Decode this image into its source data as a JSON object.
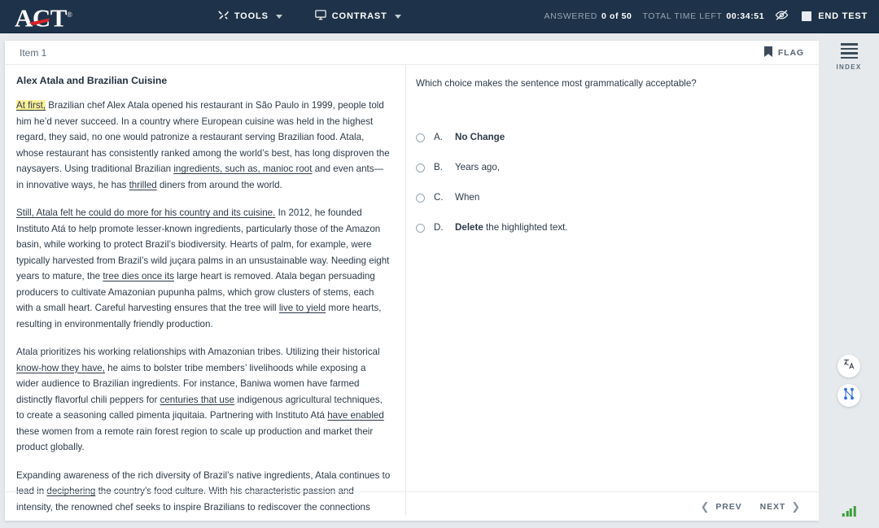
{
  "brand": {
    "name": "ACT",
    "registered": "®",
    "accent_red": "#d8232a",
    "bar_color": "#1e3349"
  },
  "topnav": {
    "tools_label": "TOOLS",
    "tools_icon": "tools-wrench-icon",
    "contrast_label": "CONTRAST",
    "contrast_icon": "monitor-icon",
    "answered_label": "ANSWERED",
    "answered_value": "0 of 50",
    "time_label": "TOTAL TIME LEFT",
    "time_value": "00:34:51",
    "hide_icon": "eye-slash-icon",
    "end_test_label": "END TEST"
  },
  "item_header": {
    "item_label": "Item 1",
    "flag_label": "FLAG",
    "flag_icon": "bookmark-flag-icon"
  },
  "passage": {
    "title": "Alex Atala and Brazilian Cuisine",
    "paragraphs": [
      {
        "segments": [
          {
            "text": "At first,",
            "style": "highlight"
          },
          {
            "text": " Brazilian chef Alex Atala opened his restaurant in São Paulo in 1999, people told him he’d never succeed. In a country where European cuisine was held in the highest regard, they said, no one would patronize a restaurant serving Brazilian food. Atala, whose restaurant has consistently ranked among the world’s best, has long disproven the naysayers. Using traditional Brazilian ",
            "style": "plain"
          },
          {
            "text": "ingredients, such as, manioc root",
            "style": "underline"
          },
          {
            "text": " and even ants—in innovative ways, he has ",
            "style": "plain"
          },
          {
            "text": "thrilled",
            "style": "underline"
          },
          {
            "text": " diners from around the world.",
            "style": "plain"
          }
        ]
      },
      {
        "segments": [
          {
            "text": "Still, Atala felt he could do more for his country and its cuisine.",
            "style": "underline"
          },
          {
            "text": " In 2012, he founded Instituto Atá to help promote lesser-known ingredients, particularly those of the Amazon basin, while working to protect Brazil’s biodiversity. Hearts of palm, for example, were typically harvested from Brazil’s wild juçara palms in an unsustainable way. Needing eight years to mature, the ",
            "style": "plain"
          },
          {
            "text": "tree dies once its",
            "style": "underline"
          },
          {
            "text": " large heart is removed. Atala began persuading producers to cultivate Amazonian pupunha palms, which grow clusters of stems, each with a small heart. Careful harvesting ensures that the tree will ",
            "style": "plain"
          },
          {
            "text": "live to yield",
            "style": "underline"
          },
          {
            "text": " more hearts, resulting in environmentally friendly production.",
            "style": "plain"
          }
        ]
      },
      {
        "segments": [
          {
            "text": "Atala prioritizes his working relationships with Amazonian tribes. Utilizing their historical ",
            "style": "plain"
          },
          {
            "text": "know-how they have,",
            "style": "underline"
          },
          {
            "text": " he aims to bolster tribe members’ livelihoods while exposing a wider audience to Brazilian ingredients. For instance, Baniwa women have farmed distinctly flavorful chili peppers for ",
            "style": "plain"
          },
          {
            "text": "centuries that use",
            "style": "underline"
          },
          {
            "text": " indigenous agricultural techniques, to create a seasoning called pimenta jiquitaia. Partnering with Instituto Atá ",
            "style": "plain"
          },
          {
            "text": "have enabled",
            "style": "underline"
          },
          {
            "text": " these women from a remote rain forest region to scale up production and market their product globally.",
            "style": "plain"
          }
        ]
      },
      {
        "segments": [
          {
            "text": "Expanding awareness of the rich diversity of Brazil’s native ingredients, Atala continues to lead in ",
            "style": "plain"
          },
          {
            "text": "deciphering",
            "style": "underline"
          },
          {
            "text": " the country’s food culture. With his characteristic passion and intensity, the renowned chef seeks to inspire Brazilians to rediscover the connections between culture, nature, and food.",
            "style": "plain"
          }
        ]
      }
    ],
    "highlight_color": "#fbf098"
  },
  "question": {
    "prompt": "Which choice makes the sentence most grammatically acceptable?",
    "choices": [
      {
        "letter": "A.",
        "bold": "No Change",
        "rest": ""
      },
      {
        "letter": "B.",
        "bold": "",
        "rest": "Years ago,"
      },
      {
        "letter": "C.",
        "bold": "",
        "rest": "When"
      },
      {
        "letter": "D.",
        "bold": "Delete",
        "rest": " the highlighted text."
      }
    ],
    "selected": null
  },
  "footer": {
    "prev_label": "PREV",
    "next_label": "NEXT",
    "prev_icon": "chevron-left-icon",
    "next_icon": "chevron-right-icon"
  },
  "rail": {
    "index_label": "INDEX",
    "index_icon": "hamburger-menu-icon",
    "translate_icon": "translate-language-icon",
    "network_icon": "network-nodes-icon",
    "signal_icon": "signal-strength-icon",
    "signal_color": "#3d9e3d"
  }
}
